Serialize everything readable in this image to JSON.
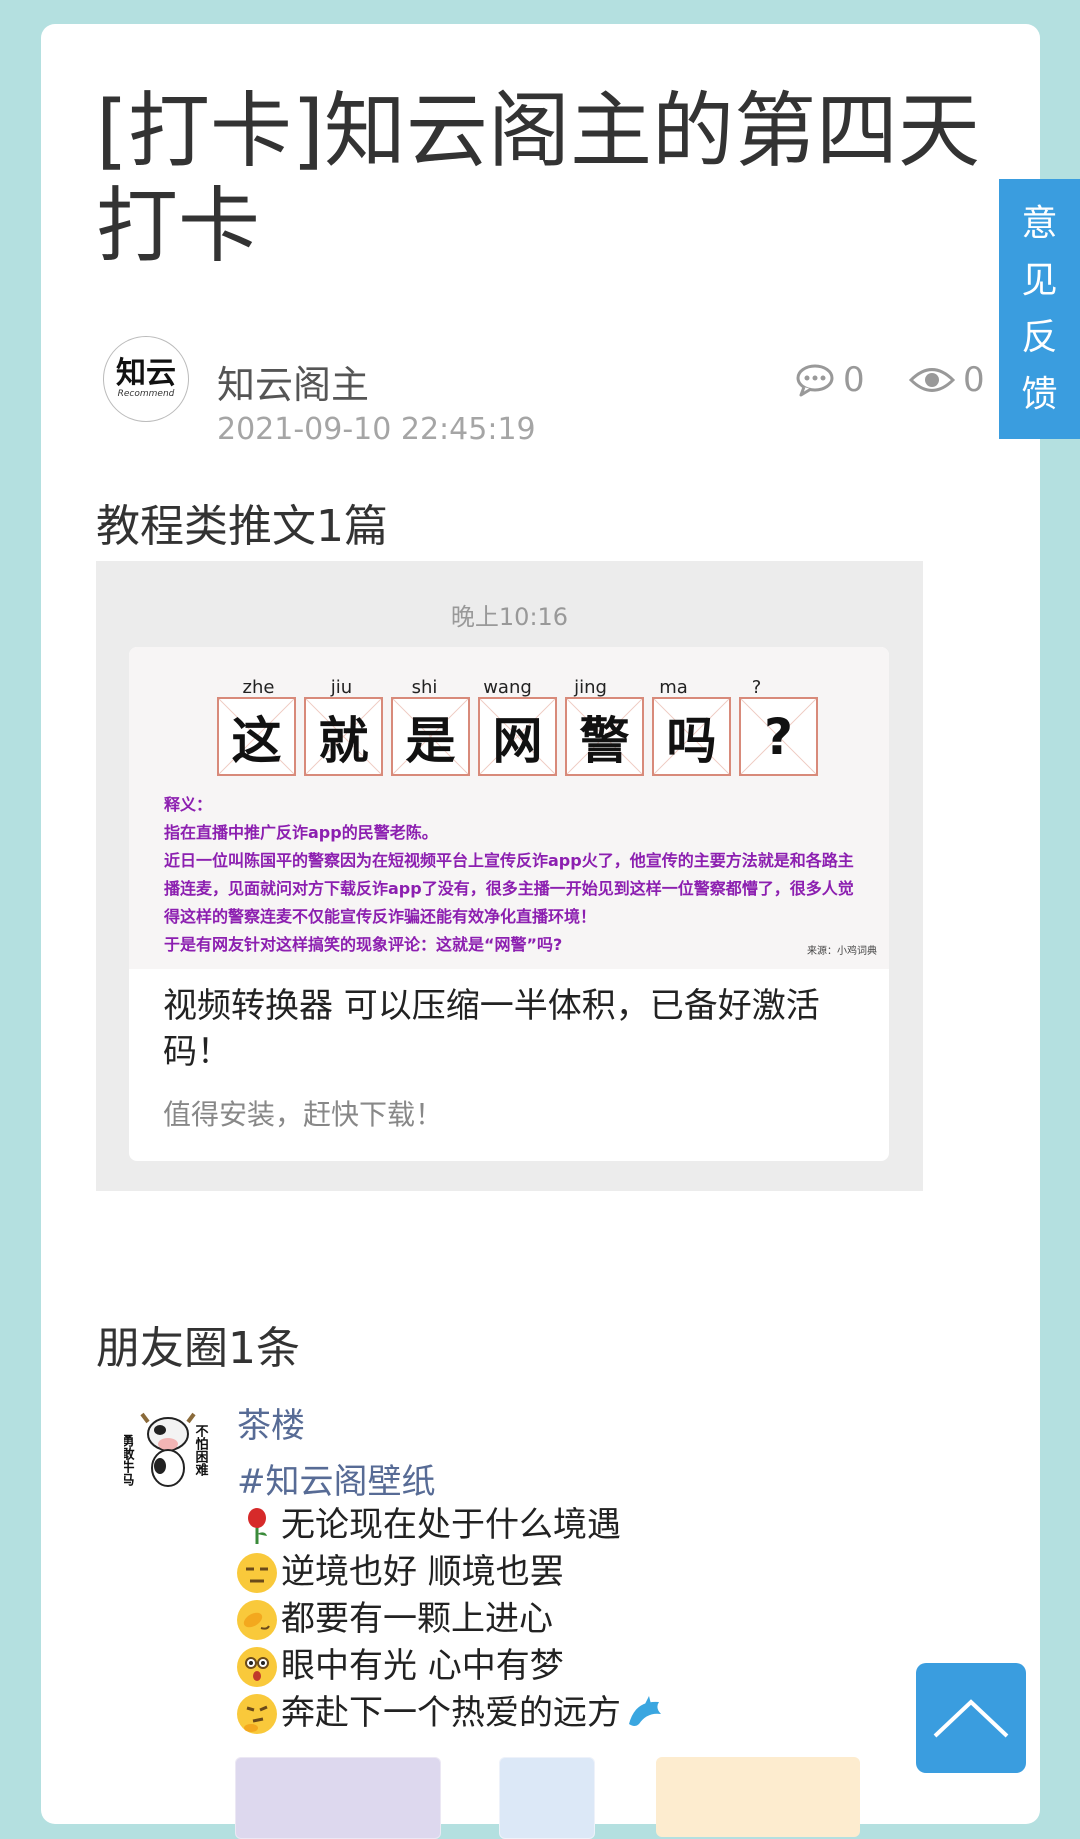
{
  "post": {
    "title": "[打卡]知云阁主的第四天打卡",
    "author": "知云阁主",
    "datetime": "2021-09-10 22:45:19",
    "comment_count": "0",
    "view_count": "0",
    "avatar_logo": "知云",
    "avatar_logo_sub": "Recommend"
  },
  "articles_section": {
    "title": "教程类推文1篇",
    "time": "晚上10:16",
    "cover": {
      "pinyin": [
        "zhe",
        "jiu",
        "shi",
        "wang",
        "jing",
        "ma",
        "?"
      ],
      "chars": [
        "这",
        "就",
        "是",
        "网",
        "警",
        "吗",
        "?"
      ],
      "line1": "释义：",
      "line2": "指在直播中推广反诈app的民警老陈。",
      "line3": "近日一位叫陈国平的警察因为在短视频平台上宣传反诈app火了，他宣传的主要方法就是和各路主播连麦，见面就问对方下载反诈app了没有，很多主播一开始见到这样一位警察都懵了，很多人觉得这样的警察连麦不仅能宣传反诈骗还能有效净化直播环境！",
      "line4": "于是有网友针对这样搞笑的现象评论：这就是“网警”吗?",
      "source": "来源：小鸡词典"
    },
    "headline": "视频转换器 可以压缩一半体积，已备好激活码！",
    "digest": "值得安装，赶快下载！"
  },
  "moments_section": {
    "title": "朋友圈1条",
    "author": "茶楼",
    "avatar_text_left": "勇敢牛马",
    "avatar_text_right": "不怕困难",
    "tag": "#知云阁壁纸",
    "lines": [
      "无论现在处于什么境遇",
      "逆境也好 顺境也罢",
      "都要有一颗上进心",
      "眼中有光 心中有梦",
      "奔赴下一个热爱的远方"
    ]
  },
  "feedback_button": [
    "意",
    "见",
    "反",
    "馈"
  ],
  "icons": {
    "comment": "comment-icon",
    "view": "eye-icon",
    "back_to_top": "chevron-up-icon"
  },
  "colors": {
    "background": "#b4e0e0",
    "accent": "#3a9ddf",
    "link": "#576b95"
  }
}
